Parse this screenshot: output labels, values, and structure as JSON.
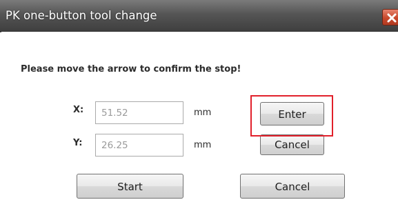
{
  "window": {
    "title": "PK one-button tool change"
  },
  "prompt": "Please move the arrow to confirm the stop!",
  "coordinates": {
    "x_label": "X:",
    "x_value": "51.52",
    "y_label": "Y:",
    "y_value": "26.25",
    "unit": "mm"
  },
  "buttons": {
    "enter": "Enter",
    "cancel_small": "Cancel",
    "start": "Start",
    "cancel": "Cancel"
  },
  "colors": {
    "highlight": "#e11f2a",
    "close_button": "#c8482b"
  }
}
